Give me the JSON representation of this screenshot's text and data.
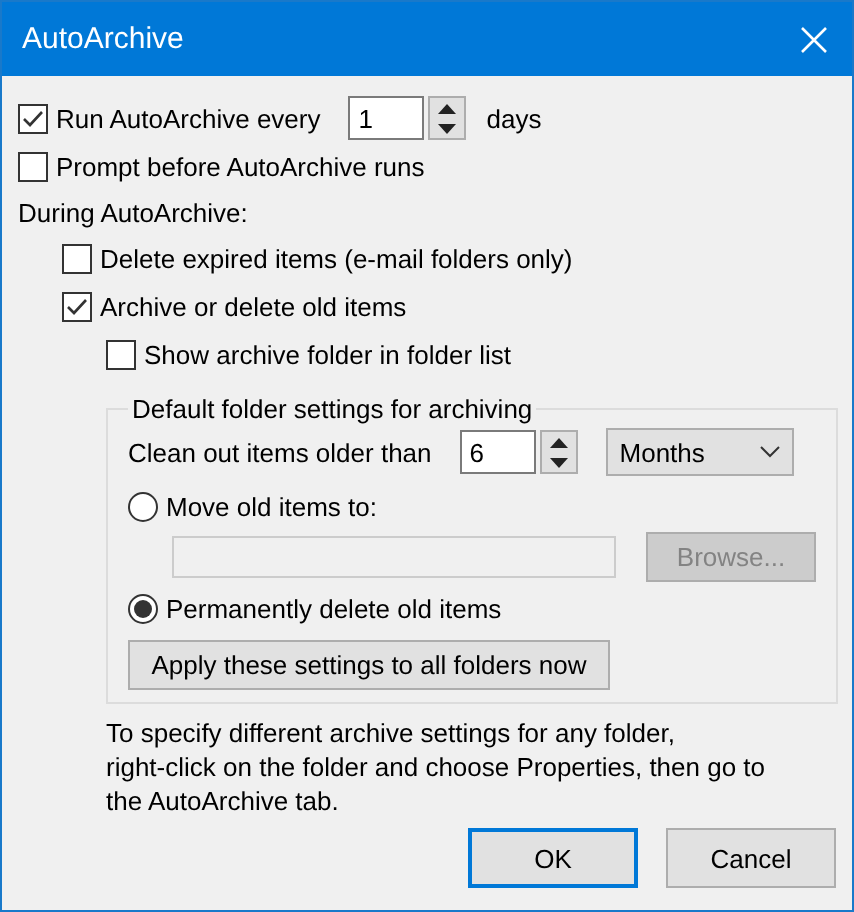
{
  "window": {
    "title": "AutoArchive"
  },
  "run": {
    "label": "Run AutoArchive every",
    "checked": true,
    "value": "1",
    "unit": "days"
  },
  "prompt": {
    "label": "Prompt before AutoArchive runs",
    "checked": false
  },
  "during_label": "During AutoArchive:",
  "options": [
    {
      "label": "Delete expired items (e-mail folders only)",
      "checked": false
    },
    {
      "label": "Archive or delete old items",
      "checked": true
    }
  ],
  "show_folder": {
    "label": "Show archive folder in folder list",
    "checked": false
  },
  "group": {
    "title": "Default folder settings for archiving",
    "clean_label": "Clean out items older than",
    "age": "6",
    "period": "Months",
    "actions": [
      {
        "kind": "move",
        "label": "Move old items to:",
        "selected": false
      },
      {
        "kind": "delete",
        "label": "Permanently delete old items",
        "selected": true
      }
    ],
    "move_path": {
      "disabled": true
    },
    "browse": {
      "label": "Browse...",
      "disabled": true
    },
    "apply": "Apply these settings to all folders now"
  },
  "note": [
    "To specify different archive settings for any folder,",
    "right-click on the folder and choose Properties, then go to",
    "the AutoArchive tab."
  ],
  "buttons": [
    {
      "label": "OK",
      "default": true
    },
    {
      "label": "Cancel",
      "default": false
    }
  ]
}
